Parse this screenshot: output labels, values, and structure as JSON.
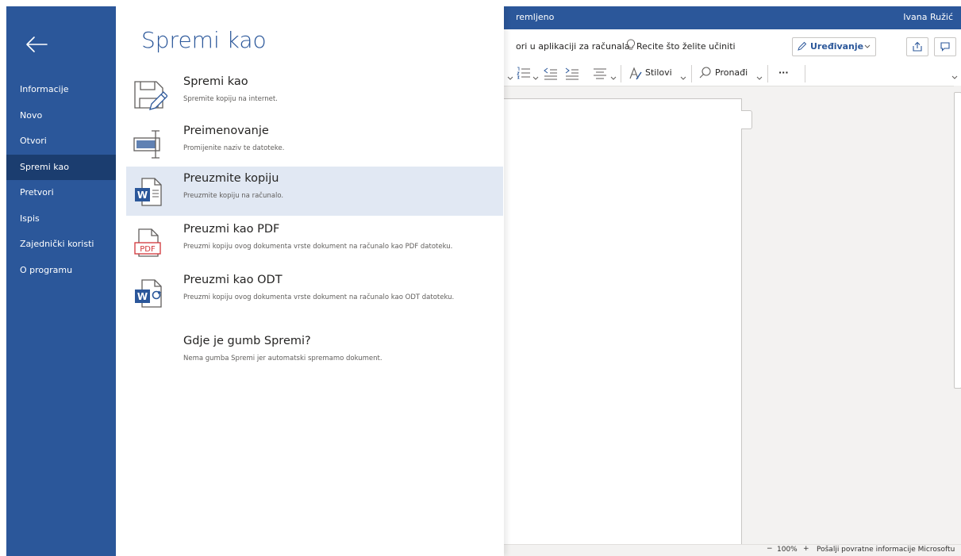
{
  "nav": {
    "items": [
      {
        "label": "Informacije"
      },
      {
        "label": "Novo"
      },
      {
        "label": "Otvori"
      },
      {
        "label": "Spremi kao"
      },
      {
        "label": "Pretvori"
      },
      {
        "label": "Ispis"
      },
      {
        "label": "Zajednički koristi"
      },
      {
        "label": "O programu"
      }
    ],
    "active_index": 3
  },
  "panel": {
    "title": "Spremi kao",
    "options": [
      {
        "title": "Spremi kao",
        "desc": "Spremite kopiju na internet.",
        "icon": "save-as-pencil-icon"
      },
      {
        "title": "Preimenovanje",
        "desc": "Promijenite naziv te datoteke.",
        "icon": "rename-icon"
      },
      {
        "title": "Preuzmite kopiju",
        "desc": "Preuzmite kopiju na računalo.",
        "icon": "word-document-icon"
      },
      {
        "title": "Preuzmi kao PDF",
        "desc": "Preuzmi kopiju ovog dokumenta vrste dokument na računalo kao PDF datoteku.",
        "icon": "pdf-document-icon"
      },
      {
        "title": "Preuzmi kao ODT",
        "desc": "Preuzmi kopiju ovog dokumenta vrste dokument na računalo kao ODT datoteku.",
        "icon": "odt-document-icon"
      }
    ],
    "selected_index": 2,
    "help_title": "Gdje je gumb Spremi?",
    "help_desc": "Nema gumba Spremi jer automatski spremamo dokument."
  },
  "word": {
    "status_title": "remljeno",
    "user_name": "Ivana Ružić",
    "open_in_desktop": "ori u aplikaciji za računala",
    "tell_me": "Recite što želite učiniti",
    "editing_label": "Uređivanje",
    "styles_label": "Stilovi",
    "find_label": "Pronađi",
    "more_label": "···",
    "word_icon_letter": "W",
    "pdf_icon_text": "PDF",
    "zoom_out": "−",
    "zoom": "100%",
    "zoom_in": "+",
    "feedback": "Pošalji povratne informacije Microsoftu"
  },
  "colors": {
    "brand": "#2b579a",
    "nav_active": "#1b3d6f",
    "selected_row": "#e1e8f3"
  }
}
